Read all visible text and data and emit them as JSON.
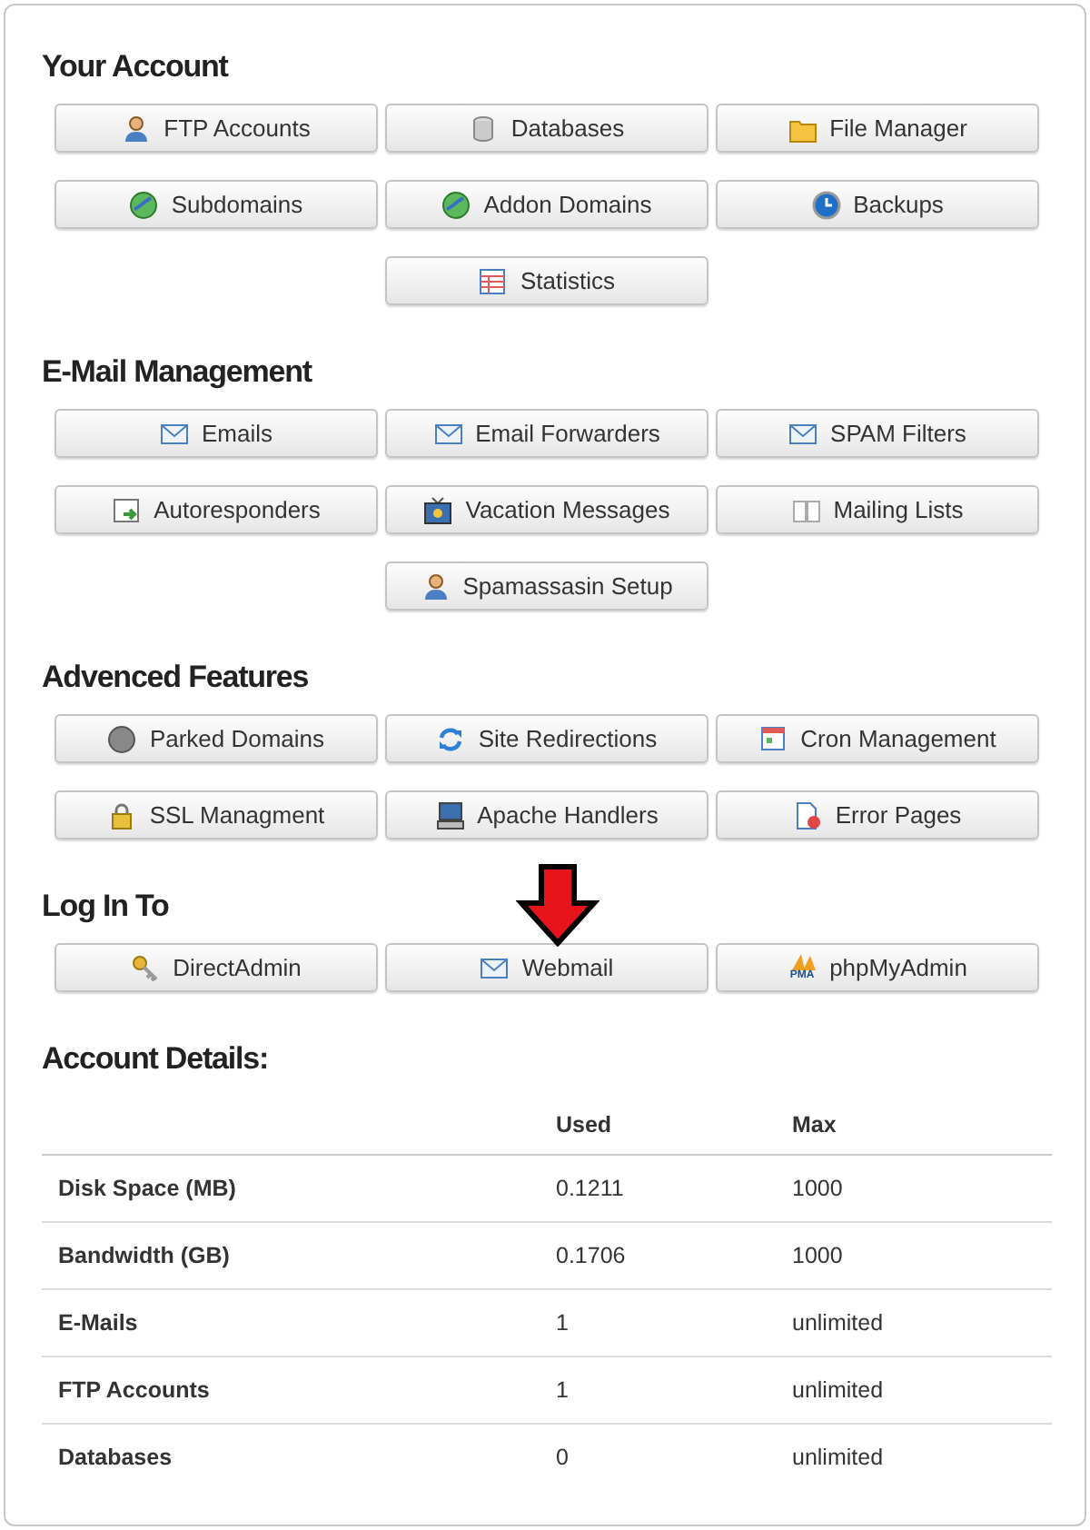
{
  "sections": [
    {
      "title": "Your Account",
      "rows": [
        [
          {
            "label": "FTP Accounts"
          },
          {
            "label": "Databases"
          },
          {
            "label": "File Manager"
          }
        ],
        [
          {
            "label": "Subdomains"
          },
          {
            "label": "Addon Domains"
          },
          {
            "label": "Backups"
          }
        ],
        [
          "",
          {
            "label": "Statistics"
          },
          ""
        ]
      ]
    },
    {
      "title": "E-Mail Management",
      "rows": [
        [
          {
            "label": "Emails"
          },
          {
            "label": "Email Forwarders"
          },
          {
            "label": "SPAM Filters"
          }
        ],
        [
          {
            "label": "Autoresponders"
          },
          {
            "label": "Vacation Messages"
          },
          {
            "label": "Mailing Lists"
          }
        ],
        [
          "",
          {
            "label": "Spamassasin Setup"
          },
          ""
        ]
      ]
    },
    {
      "title": "Advenced Features",
      "rows": [
        [
          {
            "label": "Parked Domains"
          },
          {
            "label": "Site Redirections"
          },
          {
            "label": "Cron Management"
          }
        ],
        [
          {
            "label": "SSL Managment"
          },
          {
            "label": "Apache Handlers"
          },
          {
            "label": "Error Pages"
          }
        ]
      ]
    },
    {
      "title": "Log In To",
      "rows": [
        [
          {
            "label": "DirectAdmin"
          },
          {
            "label": "Webmail"
          },
          {
            "label": "phpMyAdmin",
            "logo_text": "PMA"
          }
        ]
      ]
    }
  ],
  "account_details": {
    "title": "Account Details:",
    "columns": [
      "",
      "Used",
      "Max"
    ],
    "rows": [
      [
        "Disk Space (MB)",
        "0.1211",
        "1000"
      ],
      [
        "Bandwidth (GB)",
        "0.1706",
        "1000"
      ],
      [
        "E-Mails",
        "1",
        "unlimited"
      ],
      [
        "FTP Accounts",
        "1",
        "unlimited"
      ],
      [
        "Databases",
        "0",
        "unlimited"
      ]
    ]
  }
}
